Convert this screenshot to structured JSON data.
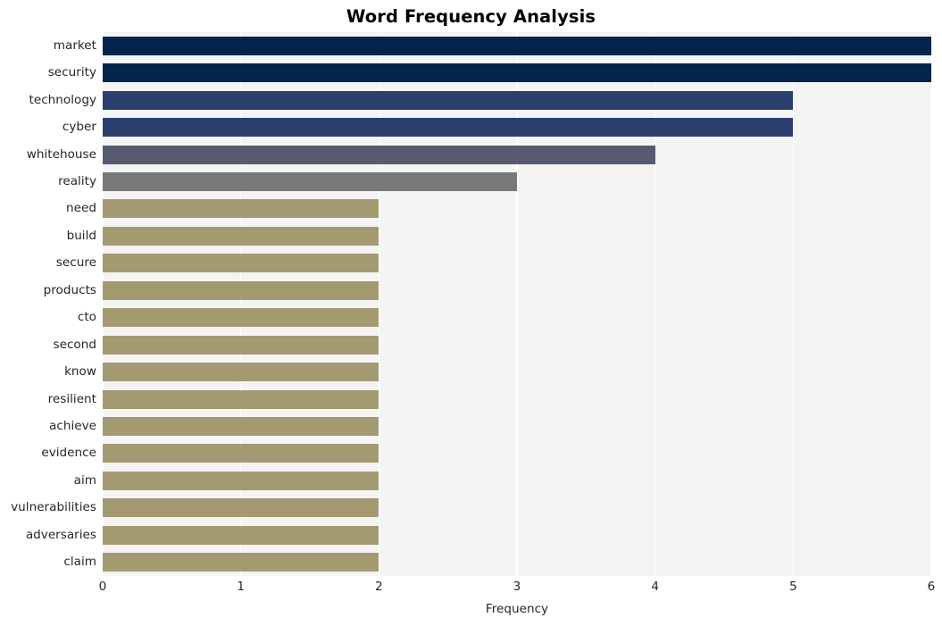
{
  "chart_data": {
    "type": "bar",
    "orientation": "horizontal",
    "title": "Word Frequency Analysis",
    "xlabel": "Frequency",
    "ylabel": "",
    "xlim": [
      0,
      6
    ],
    "xticks": [
      0,
      1,
      2,
      3,
      4,
      5,
      6
    ],
    "xtick_labels": [
      "0",
      "1",
      "2",
      "3",
      "4",
      "5",
      "6"
    ],
    "grid": true,
    "grid_axis": "x",
    "legend": false,
    "categories": [
      "market",
      "security",
      "technology",
      "cyber",
      "whitehouse",
      "reality",
      "need",
      "build",
      "secure",
      "products",
      "cto",
      "second",
      "know",
      "resilient",
      "achieve",
      "evidence",
      "aim",
      "vulnerabilities",
      "adversaries",
      "claim"
    ],
    "values": [
      6,
      6,
      5,
      5,
      4,
      3,
      2,
      2,
      2,
      2,
      2,
      2,
      2,
      2,
      2,
      2,
      2,
      2,
      2,
      2
    ],
    "bar_colors": [
      "#04234d",
      "#04234d",
      "#2b3f6e",
      "#2b3f6e",
      "#565b72",
      "#77787a",
      "#a39a71",
      "#a39a71",
      "#a39a71",
      "#a39a71",
      "#a39a71",
      "#a39a71",
      "#a39a71",
      "#a39a71",
      "#a39a71",
      "#a39a71",
      "#a39a71",
      "#a39a71",
      "#a39a71",
      "#a39a71"
    ]
  },
  "style": {
    "plot_background": "#f4f4f5",
    "figure_background": "#ffffff",
    "gridline_color": "#ffffff",
    "text_color": "#262626",
    "title_color": "#000000"
  }
}
